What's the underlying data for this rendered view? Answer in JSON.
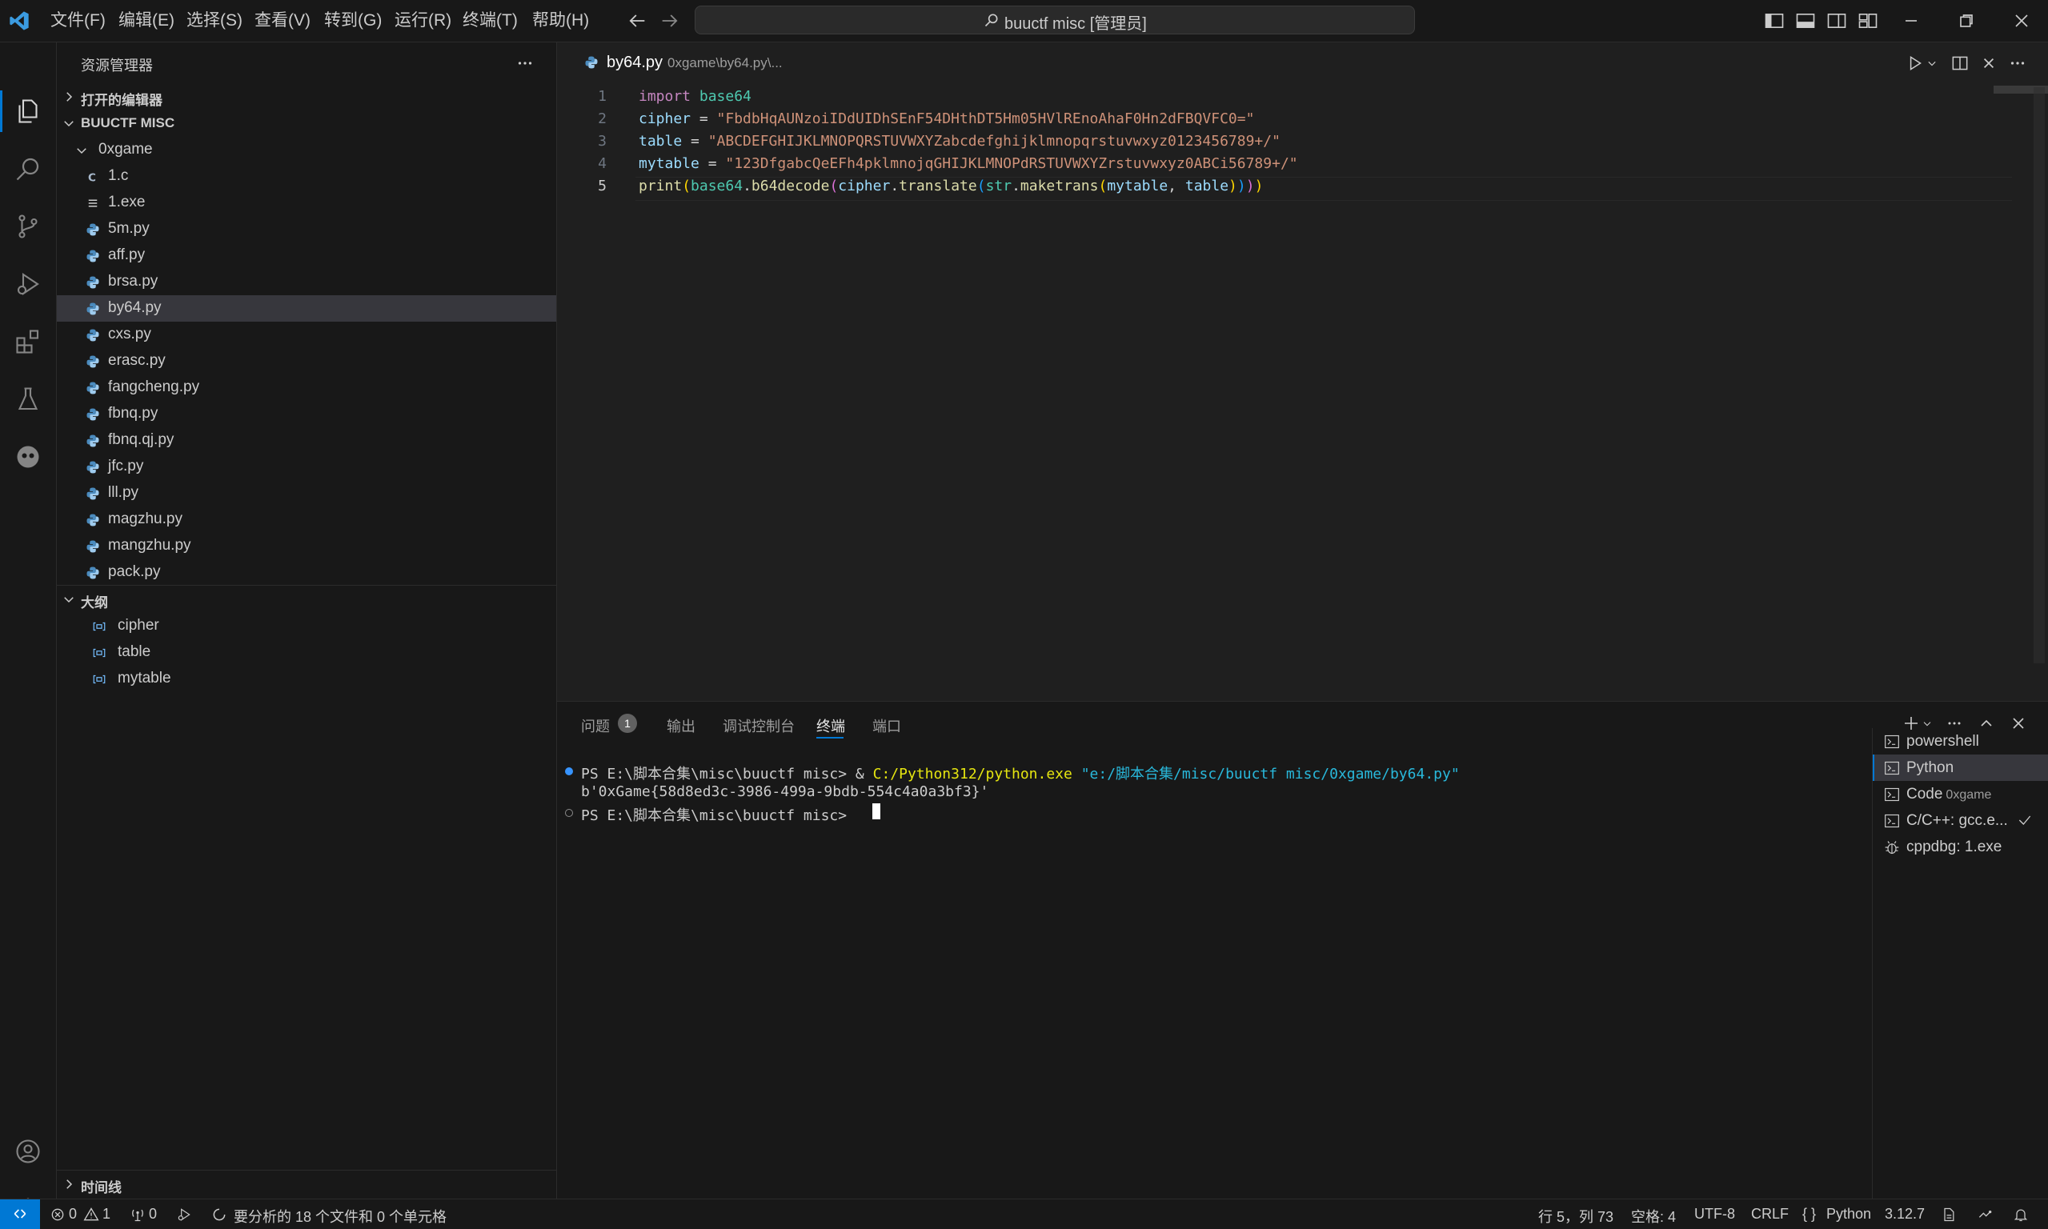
{
  "menu": [
    "文件(F)",
    "编辑(E)",
    "选择(S)",
    "查看(V)",
    "转到(G)",
    "运行(R)",
    "终端(T)",
    "帮助(H)"
  ],
  "command_center": "buuctf misc [管理员]",
  "sidebar": {
    "title": "资源管理器",
    "open_editors": "打开的编辑器",
    "workspace": "BUUCTF MISC",
    "folder": "0xgame",
    "files": [
      {
        "name": "1.c",
        "icon": "c-file-icon"
      },
      {
        "name": "1.exe",
        "icon": "binary-file-icon"
      },
      {
        "name": "5m.py",
        "icon": "python-file-icon"
      },
      {
        "name": "aff.py",
        "icon": "python-file-icon"
      },
      {
        "name": "brsa.py",
        "icon": "python-file-icon"
      },
      {
        "name": "by64.py",
        "icon": "python-file-icon",
        "selected": true
      },
      {
        "name": "cxs.py",
        "icon": "python-file-icon"
      },
      {
        "name": "erasc.py",
        "icon": "python-file-icon"
      },
      {
        "name": "fangcheng.py",
        "icon": "python-file-icon"
      },
      {
        "name": "fbnq.py",
        "icon": "python-file-icon"
      },
      {
        "name": "fbnq.qj.py",
        "icon": "python-file-icon"
      },
      {
        "name": "jfc.py",
        "icon": "python-file-icon"
      },
      {
        "name": "lll.py",
        "icon": "python-file-icon"
      },
      {
        "name": "magzhu.py",
        "icon": "python-file-icon"
      },
      {
        "name": "mangzhu.py",
        "icon": "python-file-icon"
      },
      {
        "name": "pack.py",
        "icon": "python-file-icon"
      }
    ],
    "outline": "大纲",
    "outline_items": [
      "cipher",
      "table",
      "mytable"
    ],
    "timeline": "时间线"
  },
  "editor": {
    "tab_label": "by64.py",
    "tab_path": "0xgame\\by64.py\\...",
    "line_numbers": [
      "1",
      "2",
      "3",
      "4",
      "5"
    ],
    "code": {
      "l1_kw": "import",
      "l1_mod": "base64",
      "l2_var": "cipher",
      "l2_str": "\"FbdbHqAUNzoiIDdUIDhSEnF54DHthDT5Hm05HVlREnoAhaF0Hn2dFBQVFC0=\"",
      "l3_var": "table",
      "l3_str": "\"ABCDEFGHIJKLMNOPQRSTUVWXYZabcdefghijklmnopqrstuvwxyz0123456789+/\"",
      "l4_var": "mytable",
      "l4_str": "\"123DfgabcQeEFh4pklmnojqGHIJKLMNOPdRSTUVWXYZrstuvwxyz0ABCi56789+/\"",
      "l5_print": "print",
      "l5_mod": "base64",
      "l5_b64": "b64decode",
      "l5_cipher": "cipher",
      "l5_translate": "translate",
      "l5_str": "str",
      "l5_maketrans": "maketrans",
      "l5_mytable": "mytable",
      "l5_table": "table"
    }
  },
  "panel": {
    "tabs": [
      "问题",
      "输出",
      "调试控制台",
      "终端",
      "端口"
    ],
    "active_tab": "终端",
    "problems_count": "1",
    "terminal": {
      "line1_prompt": "PS E:\\脚本合集\\misc\\buuctf misc> & ",
      "line1_exe": "C:/Python312/python.exe",
      "line1_arg": " \"e:/脚本合集/misc/buuctf misc/0xgame/by64.py\"",
      "line2": "b'0xGame{58d8ed3c-3986-499a-9bdb-554c4a0a3bf3}'",
      "line3_prompt": "PS E:\\脚本合集\\misc\\buuctf misc> "
    },
    "terminal_list": [
      {
        "label": "powershell",
        "sub": ""
      },
      {
        "label": "Python",
        "sub": "",
        "selected": true
      },
      {
        "label": "Code",
        "sub": "0xgame"
      },
      {
        "label": "C/C++: gcc.e...",
        "sub": ""
      },
      {
        "label": "cppdbg: 1.exe",
        "sub": ""
      }
    ]
  },
  "statusbar": {
    "errors": "0",
    "warnings": "1",
    "ports": "0",
    "analysis": "要分析的 18 个文件和 0 个单元格",
    "position": "行 5，列 73",
    "spaces": "空格: 4",
    "encoding": "UTF-8",
    "eol": "CRLF",
    "language": "Python",
    "python_version": "3.12.7"
  },
  "colors": {
    "accent": "#0078d4",
    "background": "#1f1f1f",
    "sidebar": "#181818",
    "selection": "#37373d"
  }
}
